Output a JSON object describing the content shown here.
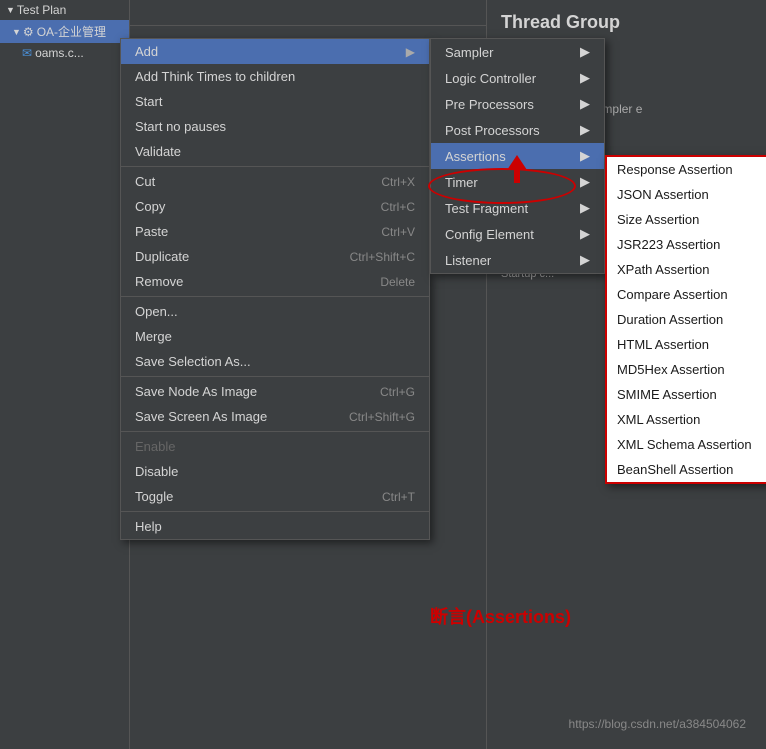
{
  "app": {
    "title": "Test Plan"
  },
  "tree": {
    "items": [
      {
        "label": "Test Plan",
        "icon": "▼",
        "level": 0
      },
      {
        "label": "OA-企业管理",
        "icon": "▼⚙",
        "level": 1,
        "selected": true
      },
      {
        "label": "oams.c...",
        "icon": "✉",
        "level": 2
      }
    ]
  },
  "context_menu": {
    "items": [
      {
        "label": "Add",
        "shortcut": "",
        "arrow": "▶",
        "active": true
      },
      {
        "label": "Add Think Times to children",
        "shortcut": ""
      },
      {
        "label": "Start",
        "shortcut": ""
      },
      {
        "label": "Start no pauses",
        "shortcut": ""
      },
      {
        "label": "Validate",
        "shortcut": ""
      },
      {
        "separator": true
      },
      {
        "label": "Cut",
        "shortcut": "Ctrl+X"
      },
      {
        "label": "Copy",
        "shortcut": "Ctrl+C"
      },
      {
        "label": "Paste",
        "shortcut": "Ctrl+V"
      },
      {
        "label": "Duplicate",
        "shortcut": "Ctrl+Shift+C"
      },
      {
        "label": "Remove",
        "shortcut": "Delete"
      },
      {
        "separator": true
      },
      {
        "label": "Open...",
        "shortcut": ""
      },
      {
        "label": "Merge",
        "shortcut": ""
      },
      {
        "label": "Save Selection As...",
        "shortcut": ""
      },
      {
        "separator": true
      },
      {
        "label": "Save Node As Image",
        "shortcut": "Ctrl+G"
      },
      {
        "label": "Save Screen As Image",
        "shortcut": "Ctrl+Shift+G"
      },
      {
        "separator": true
      },
      {
        "label": "Enable",
        "shortcut": "",
        "disabled": true
      },
      {
        "label": "Disable",
        "shortcut": ""
      },
      {
        "label": "Toggle",
        "shortcut": "Ctrl+T"
      },
      {
        "separator": true
      },
      {
        "label": "Help",
        "shortcut": ""
      }
    ]
  },
  "submenu_add": {
    "items": [
      {
        "label": "Sampler",
        "arrow": "▶"
      },
      {
        "label": "Logic Controller",
        "arrow": "▶"
      },
      {
        "label": "Pre Processors",
        "arrow": "▶"
      },
      {
        "label": "Post Processors",
        "arrow": "▶"
      },
      {
        "label": "Assertions",
        "arrow": "▶",
        "active": true
      },
      {
        "label": "Timer",
        "arrow": "▶"
      },
      {
        "label": "Test Fragment",
        "arrow": "▶"
      },
      {
        "label": "Config Element",
        "arrow": "▶"
      },
      {
        "label": "Listener",
        "arrow": "▶"
      }
    ]
  },
  "submenu_assertions": {
    "items": [
      "Response Assertion",
      "JSON Assertion",
      "Size Assertion",
      "JSR223 Assertion",
      "XPath Assertion",
      "Compare Assertion",
      "Duration Assertion",
      "HTML Assertion",
      "MD5Hex Assertion",
      "SMIME Assertion",
      "XML Assertion",
      "XML Schema Assertion",
      "BeanShell Assertion"
    ]
  },
  "right_panel": {
    "title": "Thread Group",
    "fields": [
      {
        "label": "OA-企业管理"
      },
      {
        "label": ":"
      },
      {
        "label": "be taken after a Sampler e"
      }
    ]
  },
  "annotation": {
    "text": "断言(Assertions)",
    "url": "https://blog.csdn.net/a384504062"
  }
}
